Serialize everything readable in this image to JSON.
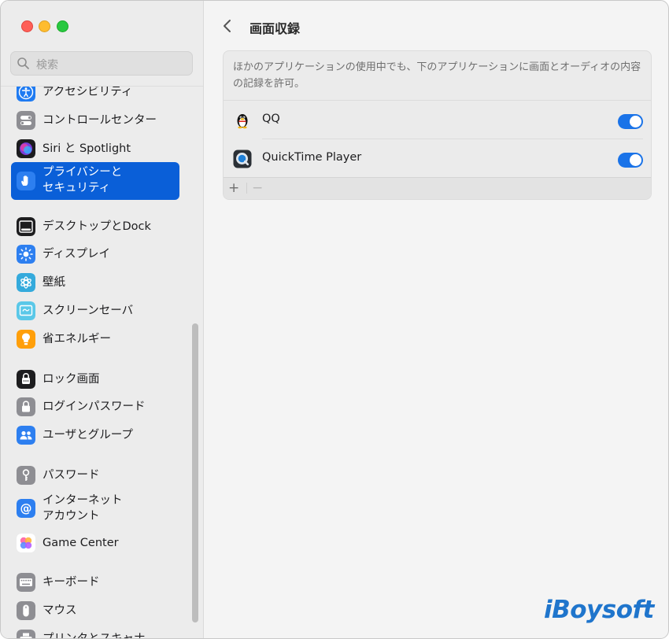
{
  "window": {
    "traffic_lights": [
      "close",
      "minimize",
      "zoom"
    ]
  },
  "search": {
    "placeholder": "検索"
  },
  "sidebar": {
    "items": [
      {
        "label": "アクセシビリティ",
        "icon": "accessibility-icon",
        "color": "#1f7bf2"
      },
      {
        "label": "コントロールセンター",
        "icon": "control-center-icon",
        "color": "#8e8e93"
      },
      {
        "label": "Siri と Spotlight",
        "icon": "siri-icon",
        "color": "#c442d8"
      },
      {
        "label": "プライバシーと\nセキュリティ",
        "icon": "hand-icon",
        "color": "#2d7ff0",
        "active": true
      },
      {
        "label": "デスクトップとDock",
        "icon": "dock-icon",
        "color": "#1d1d1f"
      },
      {
        "label": "ディスプレイ",
        "icon": "display-icon",
        "color": "#2d7ff0"
      },
      {
        "label": "壁紙",
        "icon": "wallpaper-icon",
        "color": "#34aadc"
      },
      {
        "label": "スクリーンセーバ",
        "icon": "screensaver-icon",
        "color": "#5ac8e8"
      },
      {
        "label": "省エネルギー",
        "icon": "energy-icon",
        "color": "#ff9f0a"
      },
      {
        "label": "ロック画面",
        "icon": "lock-icon",
        "color": "#1d1d1f"
      },
      {
        "label": "ログインパスワード",
        "icon": "login-lock-icon",
        "color": "#8e8e93"
      },
      {
        "label": "ユーザとグループ",
        "icon": "users-icon",
        "color": "#2d7ff0"
      },
      {
        "label": "パスワード",
        "icon": "key-icon",
        "color": "#8e8e93"
      },
      {
        "label": "インターネット\nアカウント",
        "icon": "at-icon",
        "color": "#2d7ff0"
      },
      {
        "label": "Game Center",
        "icon": "game-center-icon",
        "color": "#ff5fa2"
      },
      {
        "label": "キーボード",
        "icon": "keyboard-icon",
        "color": "#8e8e93"
      },
      {
        "label": "マウス",
        "icon": "mouse-icon",
        "color": "#8e8e93"
      },
      {
        "label": "プリンタとスキャナ",
        "icon": "printer-icon",
        "color": "#8e8e93"
      }
    ]
  },
  "main": {
    "title": "画面収録",
    "description": "ほかのアプリケーションの使用中でも、下のアプリケーションに画面とオーディオの内容の記録を許可。",
    "apps": [
      {
        "name": "QQ",
        "icon": "qq-penguin-icon",
        "enabled": true
      },
      {
        "name": "QuickTime Player",
        "icon": "quicktime-icon",
        "enabled": true
      }
    ],
    "add_label": "+",
    "remove_label": "−"
  },
  "watermark": {
    "text": "iBoysoft"
  },
  "colors": {
    "accent": "#0a5fd8",
    "toggle_on": "#1a73e8",
    "logo": "#1f75cc"
  }
}
